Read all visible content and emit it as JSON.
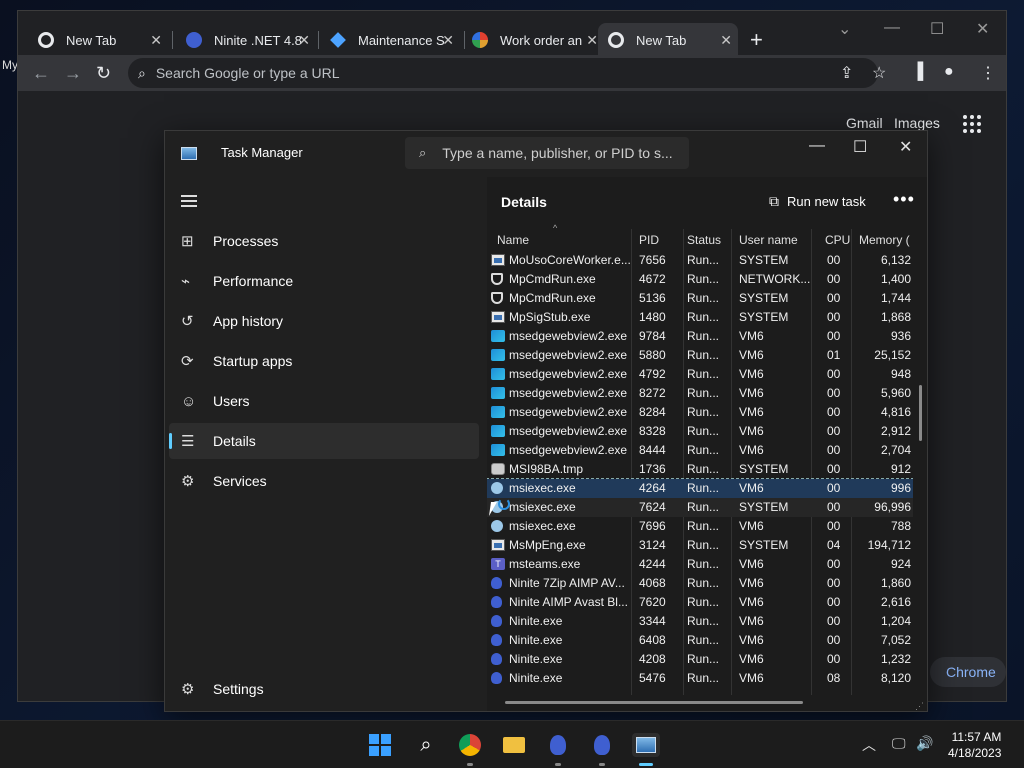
{
  "desktop": {
    "label": "My"
  },
  "chrome": {
    "tabs": [
      {
        "label": "New Tab",
        "icon": "chrome-icon",
        "color": "#e8eaed"
      },
      {
        "label": "Ninite .NET 4.8",
        "icon": "ninite-icon",
        "color": "#3f5fd0"
      },
      {
        "label": "Maintenance S",
        "icon": "maintenance-icon",
        "color": "#4da3ff"
      },
      {
        "label": "Work order an",
        "icon": "workorder-icon",
        "color": "#e0a030"
      },
      {
        "label": "New Tab",
        "icon": "chrome-icon",
        "color": "#e8eaed"
      }
    ],
    "omnibox_placeholder": "Search Google or type a URL",
    "links": {
      "gmail": "Gmail",
      "images": "Images"
    },
    "pill": "Chrome"
  },
  "taskmanager": {
    "title": "Task Manager",
    "search_placeholder": "Type a name, publisher, or PID to s...",
    "nav": [
      {
        "label": "Processes",
        "icon": "processes-icon"
      },
      {
        "label": "Performance",
        "icon": "performance-icon"
      },
      {
        "label": "App history",
        "icon": "app-history-icon"
      },
      {
        "label": "Startup apps",
        "icon": "startup-apps-icon"
      },
      {
        "label": "Users",
        "icon": "users-icon"
      },
      {
        "label": "Details",
        "icon": "details-icon"
      },
      {
        "label": "Services",
        "icon": "services-icon"
      }
    ],
    "settings": "Settings",
    "details_title": "Details",
    "run_new_task": "Run new task",
    "columns": {
      "name": "Name",
      "pid": "PID",
      "status": "Status",
      "user": "User name",
      "cpu": "CPU",
      "memory": "Memory ("
    },
    "rows": [
      {
        "icon": "win",
        "name": "MoUsoCoreWorker.e...",
        "pid": "7656",
        "status": "Run...",
        "user": "SYSTEM",
        "cpu": "00",
        "mem": "6,132"
      },
      {
        "icon": "shield",
        "name": "MpCmdRun.exe",
        "pid": "4672",
        "status": "Run...",
        "user": "NETWORK...",
        "cpu": "00",
        "mem": "1,400"
      },
      {
        "icon": "shield",
        "name": "MpCmdRun.exe",
        "pid": "5136",
        "status": "Run...",
        "user": "SYSTEM",
        "cpu": "00",
        "mem": "1,744"
      },
      {
        "icon": "win",
        "name": "MpSigStub.exe",
        "pid": "1480",
        "status": "Run...",
        "user": "SYSTEM",
        "cpu": "00",
        "mem": "1,868"
      },
      {
        "icon": "edge",
        "name": "msedgewebview2.exe",
        "pid": "9784",
        "status": "Run...",
        "user": "VM6",
        "cpu": "00",
        "mem": "936"
      },
      {
        "icon": "edge",
        "name": "msedgewebview2.exe",
        "pid": "5880",
        "status": "Run...",
        "user": "VM6",
        "cpu": "01",
        "mem": "25,152"
      },
      {
        "icon": "edge",
        "name": "msedgewebview2.exe",
        "pid": "4792",
        "status": "Run...",
        "user": "VM6",
        "cpu": "00",
        "mem": "948"
      },
      {
        "icon": "edge",
        "name": "msedgewebview2.exe",
        "pid": "8272",
        "status": "Run...",
        "user": "VM6",
        "cpu": "00",
        "mem": "5,960"
      },
      {
        "icon": "edge",
        "name": "msedgewebview2.exe",
        "pid": "8284",
        "status": "Run...",
        "user": "VM6",
        "cpu": "00",
        "mem": "4,816"
      },
      {
        "icon": "edge",
        "name": "msedgewebview2.exe",
        "pid": "8328",
        "status": "Run...",
        "user": "VM6",
        "cpu": "00",
        "mem": "2,912"
      },
      {
        "icon": "edge",
        "name": "msedgewebview2.exe",
        "pid": "8444",
        "status": "Run...",
        "user": "VM6",
        "cpu": "00",
        "mem": "2,704"
      },
      {
        "icon": "msi",
        "name": "MSI98BA.tmp",
        "pid": "1736",
        "status": "Run...",
        "user": "SYSTEM",
        "cpu": "00",
        "mem": "912"
      },
      {
        "icon": "disc",
        "name": "msiexec.exe",
        "pid": "4264",
        "status": "Run...",
        "user": "VM6",
        "cpu": "00",
        "mem": "996",
        "state": "sel"
      },
      {
        "icon": "disc",
        "name": "msiexec.exe",
        "pid": "7624",
        "status": "Run...",
        "user": "SYSTEM",
        "cpu": "00",
        "mem": "96,996",
        "state": "hover"
      },
      {
        "icon": "disc",
        "name": "msiexec.exe",
        "pid": "7696",
        "status": "Run...",
        "user": "VM6",
        "cpu": "00",
        "mem": "788"
      },
      {
        "icon": "win",
        "name": "MsMpEng.exe",
        "pid": "3124",
        "status": "Run...",
        "user": "SYSTEM",
        "cpu": "04",
        "mem": "194,712"
      },
      {
        "icon": "teams",
        "name": "msteams.exe",
        "pid": "4244",
        "status": "Run...",
        "user": "VM6",
        "cpu": "00",
        "mem": "924"
      },
      {
        "icon": "ninite",
        "name": "Ninite 7Zip AIMP AV...",
        "pid": "4068",
        "status": "Run...",
        "user": "VM6",
        "cpu": "00",
        "mem": "1,860"
      },
      {
        "icon": "ninite",
        "name": "Ninite AIMP Avast Bl...",
        "pid": "7620",
        "status": "Run...",
        "user": "VM6",
        "cpu": "00",
        "mem": "2,616"
      },
      {
        "icon": "ninite",
        "name": "Ninite.exe",
        "pid": "3344",
        "status": "Run...",
        "user": "VM6",
        "cpu": "00",
        "mem": "1,204"
      },
      {
        "icon": "ninite",
        "name": "Ninite.exe",
        "pid": "6408",
        "status": "Run...",
        "user": "VM6",
        "cpu": "00",
        "mem": "7,052"
      },
      {
        "icon": "ninite",
        "name": "Ninite.exe",
        "pid": "4208",
        "status": "Run...",
        "user": "VM6",
        "cpu": "00",
        "mem": "1,232"
      },
      {
        "icon": "ninite",
        "name": "Ninite.exe",
        "pid": "5476",
        "status": "Run...",
        "user": "VM6",
        "cpu": "08",
        "mem": "8,120"
      }
    ]
  },
  "taskbar": {
    "time": "11:57 AM",
    "date": "4/18/2023"
  }
}
